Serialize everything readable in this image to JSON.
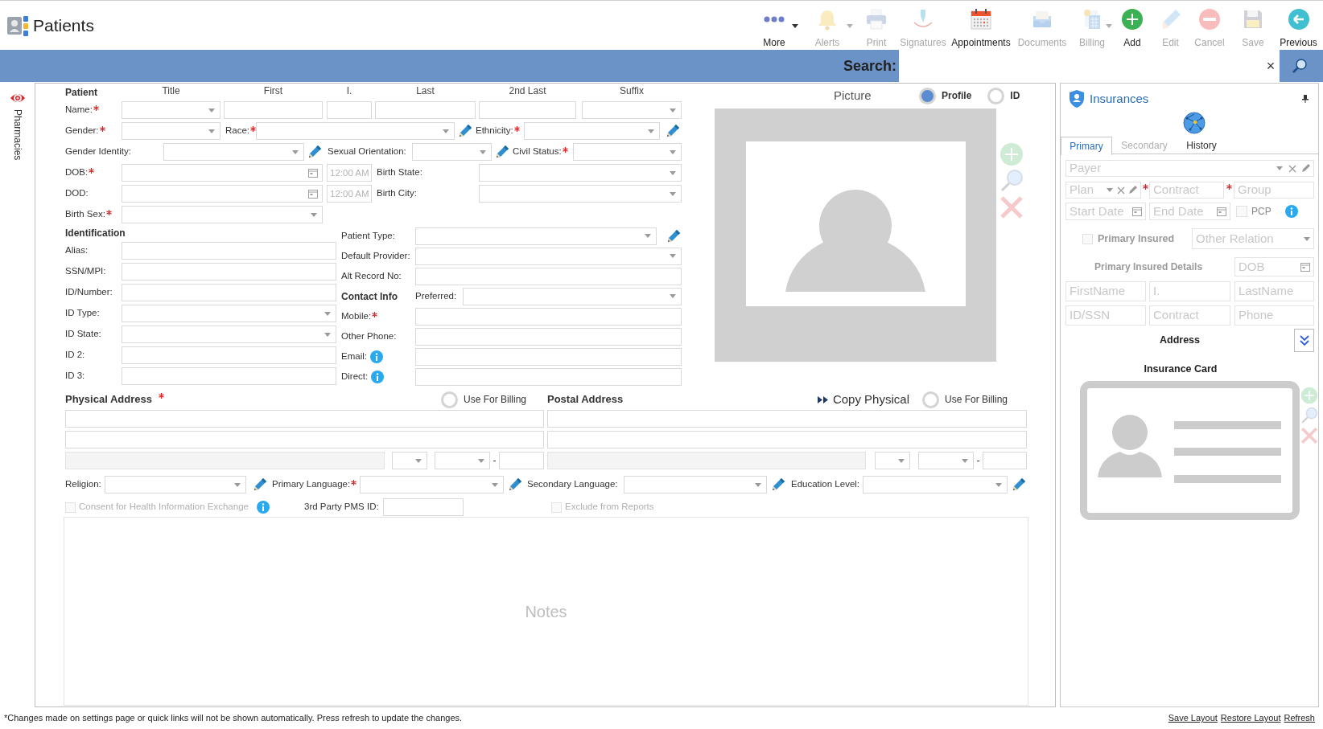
{
  "app": {
    "title": "Patients"
  },
  "toolbar": [
    {
      "kind": "more",
      "label": "More",
      "disabled": false,
      "dropdown": true
    },
    {
      "kind": "bell",
      "label": "Alerts",
      "disabled": true,
      "dropdown": true
    },
    {
      "kind": "printer",
      "label": "Print",
      "disabled": true,
      "dropdown": false
    },
    {
      "kind": "signature",
      "label": "Signatures",
      "disabled": true,
      "dropdown": false
    },
    {
      "kind": "calendar",
      "label": "Appointments",
      "disabled": false,
      "dropdown": false
    },
    {
      "kind": "tray",
      "label": "Documents",
      "disabled": true,
      "dropdown": false
    },
    {
      "kind": "billing",
      "label": "Billing",
      "disabled": true,
      "dropdown": true
    },
    {
      "kind": "add",
      "label": "Add",
      "disabled": false,
      "dropdown": false
    },
    {
      "kind": "edit",
      "label": "Edit",
      "disabled": true,
      "dropdown": false
    },
    {
      "kind": "cancel",
      "label": "Cancel",
      "disabled": true,
      "dropdown": false
    },
    {
      "kind": "save",
      "label": "Save",
      "disabled": true,
      "dropdown": false
    },
    {
      "kind": "previous",
      "label": "Previous",
      "disabled": false,
      "dropdown": false
    }
  ],
  "search": {
    "label": "Search:",
    "clear": "×"
  },
  "side_tabs": [
    {
      "label": "Pharmacies"
    }
  ],
  "patient": {
    "heading": "Patient",
    "column_headers": [
      "Title",
      "First",
      "I.",
      "Last",
      "2nd Last",
      "Suffix"
    ],
    "fields": [
      {
        "label": "Name:",
        "required": true
      },
      {
        "label": "Gender:",
        "required": true
      },
      {
        "label": "Race:",
        "required": true
      },
      {
        "label": "Ethnicity:",
        "required": true
      },
      {
        "label": "Gender Identity:",
        "required": false
      },
      {
        "label": "Sexual Orientation:",
        "required": false
      },
      {
        "label": "Civil Status:",
        "required": true
      },
      {
        "label": "DOB:",
        "required": true,
        "time_placeholder": "12:00 AM"
      },
      {
        "label": "Birth State:",
        "required": false
      },
      {
        "label": "DOD:",
        "required": false,
        "time_placeholder": "12:00 AM"
      },
      {
        "label": "Birth City:",
        "required": false
      },
      {
        "label": "Birth Sex:",
        "required": true
      }
    ]
  },
  "identification": {
    "heading": "Identification",
    "fields": [
      {
        "label": "Alias:",
        "kind": "text",
        "required": false
      },
      {
        "label": "SSN/MPI:",
        "kind": "text",
        "required": false
      },
      {
        "label": "ID/Number:",
        "kind": "text",
        "required": false
      },
      {
        "label": "ID Type:",
        "kind": "select",
        "required": false
      },
      {
        "label": "ID State:",
        "kind": "select",
        "required": false
      },
      {
        "label": "ID 2:",
        "kind": "text",
        "required": false
      },
      {
        "label": "ID 3:",
        "kind": "text",
        "required": false
      }
    ]
  },
  "details": {
    "fields": [
      {
        "label": "Patient Type:",
        "kind": "select",
        "required": false,
        "edit": true
      },
      {
        "label": "Default Provider:",
        "kind": "select",
        "required": false,
        "edit": false
      },
      {
        "label": "Alt Record No:",
        "kind": "text",
        "required": false,
        "edit": false
      }
    ]
  },
  "contact_info": {
    "heading": "Contact Info",
    "fields": [
      {
        "label": "Preferred:",
        "kind": "select",
        "required": false,
        "info": false
      },
      {
        "label": "Mobile:",
        "kind": "text",
        "required": true,
        "info": false
      },
      {
        "label": "Other Phone:",
        "kind": "text",
        "required": false,
        "info": false
      },
      {
        "label": "Email:",
        "kind": "text",
        "required": false,
        "info": true
      },
      {
        "label": "Direct:",
        "kind": "text",
        "required": false,
        "info": true
      }
    ]
  },
  "picture": {
    "label": "Picture",
    "options": [
      {
        "label": "Profile",
        "selected": true
      },
      {
        "label": "ID",
        "selected": false
      }
    ]
  },
  "physical_address": {
    "heading": "Physical Address",
    "required": true,
    "use_for_billing": {
      "label": "Use For Billing",
      "selected": false
    },
    "zip_separator": "-"
  },
  "postal_address": {
    "heading": "Postal Address",
    "required": false,
    "copy_button": "Copy Physical",
    "use_for_billing": {
      "label": "Use For Billing",
      "selected": false
    },
    "zip_separator": "-"
  },
  "languages": [
    {
      "label": "Religion:",
      "required": false
    },
    {
      "label": "Primary Language:",
      "required": true
    },
    {
      "label": "Secondary Language:",
      "required": false
    },
    {
      "label": "Education Level:",
      "required": false
    }
  ],
  "options_row": {
    "consent": {
      "label": "Consent for Health Information Exchange",
      "checked": false,
      "disabled": true
    },
    "pms_id_label": "3rd Party PMS ID:",
    "exclude": {
      "label": "Exclude from Reports",
      "checked": false,
      "disabled": true
    }
  },
  "notes": {
    "placeholder": "Notes"
  },
  "insurances": {
    "title": "Insurances",
    "tabs": [
      {
        "label": "Primary",
        "selected": true,
        "disabled": false
      },
      {
        "label": "Secondary",
        "selected": false,
        "disabled": true
      },
      {
        "label": "History",
        "selected": false,
        "disabled": false
      }
    ],
    "payer": {
      "placeholder": "Payer"
    },
    "plan": {
      "placeholder": "Plan"
    },
    "contract": {
      "placeholder": "Contract",
      "required": true
    },
    "group": {
      "placeholder": "Group",
      "required": true
    },
    "start_date": {
      "placeholder": "Start Date"
    },
    "end_date": {
      "placeholder": "End Date"
    },
    "pcp": {
      "label": "PCP",
      "checked": false,
      "disabled": true
    },
    "primary_insured": {
      "label": "Primary Insured",
      "checked": false,
      "disabled": true
    },
    "relation": {
      "placeholder": "Other Relation"
    },
    "details_heading": "Primary Insured Details",
    "dob": {
      "placeholder": "DOB"
    },
    "insured_fields": [
      {
        "placeholder": "FirstName"
      },
      {
        "placeholder": "I."
      },
      {
        "placeholder": "LastName"
      },
      {
        "placeholder": "ID/SSN"
      },
      {
        "placeholder": "Contract"
      },
      {
        "placeholder": "Phone"
      }
    ],
    "address_heading": "Address",
    "card_heading": "Insurance Card"
  },
  "footer": {
    "note": "*Changes made on settings page or quick links will not be shown automatically. Press refresh to update the changes.",
    "links": [
      "Save Layout",
      "Restore Layout",
      "Refresh"
    ]
  }
}
